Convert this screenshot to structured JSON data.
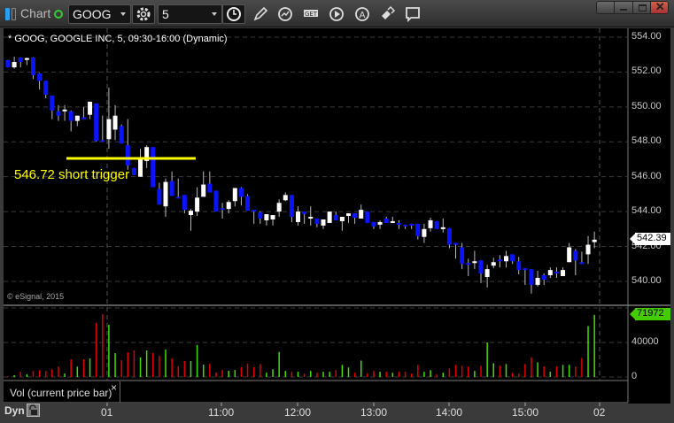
{
  "window": {
    "title": "Chart",
    "status_color": "#3c3"
  },
  "toolbar": {
    "symbol": "GOOG",
    "interval": "5",
    "tools": [
      "pencil-icon",
      "study-icon",
      "get-icon",
      "play-icon",
      "alert-icon",
      "link-icon",
      "comment-icon"
    ]
  },
  "chart": {
    "header": "* GOOG, GOOGLE INC, 5, 09:30-16:00 (Dynamic)",
    "copyright": "© eSignal, 2015",
    "annotation": "546.72 short trigger",
    "price_labels": [
      "554.00",
      "552.00",
      "550.00",
      "548.00",
      "546.00",
      "544.00",
      "542.00",
      "540.00"
    ],
    "price_values": [
      554,
      552,
      550,
      548,
      546,
      544,
      542,
      540
    ],
    "last_price": "542.39",
    "volume_labels": [
      "40000",
      "0"
    ],
    "volume_values": [
      40000,
      0
    ],
    "last_volume": "71972",
    "study_label": "Vol (current price bar)",
    "close_study": "×",
    "time_mode": "Dyn",
    "time_labels": [
      "01",
      "11:00",
      "12:00",
      "13:00",
      "14:00",
      "15:00",
      "02"
    ],
    "colors": {
      "up": "#ffffff",
      "down": "#0a14ff",
      "vol_up": "#44dd00",
      "vol_down": "#e00000",
      "trigger": "#ffff00"
    },
    "candles_ohlcv": [
      [
        552.68,
        552.7,
        552.27,
        552.27,
        1000
      ],
      [
        552.27,
        552.88,
        552.2,
        552.58,
        2000
      ],
      [
        552.83,
        552.85,
        552.27,
        552.58,
        6000
      ],
      [
        552.7,
        552.82,
        552.4,
        552.8,
        3000
      ],
      [
        552.83,
        552.85,
        551.6,
        551.82,
        7000
      ],
      [
        551.92,
        551.95,
        551.0,
        551.5,
        8000
      ],
      [
        551.5,
        551.5,
        550.5,
        550.7,
        7000
      ],
      [
        550.65,
        550.65,
        549.3,
        549.8,
        9000
      ],
      [
        549.75,
        550.1,
        549.2,
        549.5,
        12000
      ],
      [
        549.75,
        550.1,
        549.2,
        549.85,
        4000
      ],
      [
        549.75,
        549.8,
        548.6,
        549.2,
        20500
      ],
      [
        549.2,
        549.5,
        548.9,
        549.5,
        12000
      ],
      [
        549.4,
        550.0,
        549.3,
        549.3,
        20500
      ],
      [
        549.55,
        550.3,
        549.3,
        550.3,
        21500
      ],
      [
        550.2,
        550.2,
        548.0,
        548.05,
        62600
      ],
      [
        548.1,
        549.5,
        548.0,
        548.0,
        72800
      ],
      [
        548.15,
        551.1,
        547.6,
        549.3,
        60500
      ],
      [
        548.7,
        550.1,
        548.1,
        549.5,
        27700
      ],
      [
        548.9,
        549.0,
        547.9,
        547.9,
        19500
      ],
      [
        547.8,
        549.3,
        546.4,
        546.65,
        28700
      ],
      [
        546.5,
        546.5,
        546.1,
        546.1,
        30800
      ],
      [
        546.0,
        547.6,
        546.0,
        547.0,
        22600
      ],
      [
        546.9,
        547.8,
        546.5,
        547.7,
        30800
      ],
      [
        547.7,
        547.7,
        545.4,
        545.4,
        27700
      ],
      [
        545.3,
        545.65,
        544.4,
        544.4,
        24600
      ],
      [
        544.3,
        545.9,
        543.7,
        545.7,
        31800
      ],
      [
        545.75,
        546.3,
        544.9,
        544.9,
        21500
      ],
      [
        544.85,
        545.9,
        544.75,
        544.75,
        12300
      ],
      [
        544.95,
        544.95,
        543.9,
        544.1,
        18500
      ],
      [
        543.8,
        544.15,
        542.9,
        544.05,
        18500
      ],
      [
        544.0,
        545.4,
        543.75,
        544.8,
        37000
      ],
      [
        544.85,
        546.3,
        544.85,
        545.55,
        14400
      ],
      [
        545.6,
        546.3,
        545.1,
        545.1,
        15400
      ],
      [
        545.2,
        545.2,
        544.0,
        544.0,
        5500
      ],
      [
        544.2,
        544.5,
        543.6,
        544.1,
        8200
      ],
      [
        544.15,
        544.65,
        543.9,
        544.55,
        7200
      ],
      [
        544.6,
        545.35,
        544.3,
        545.35,
        8200
      ],
      [
        545.35,
        545.4,
        544.35,
        544.85,
        11300
      ],
      [
        544.9,
        545.0,
        544.05,
        544.05,
        15400
      ],
      [
        544.1,
        544.1,
        543.3,
        544.0,
        11300
      ],
      [
        543.95,
        544.0,
        543.3,
        543.6,
        15000
      ],
      [
        543.5,
        543.85,
        543.2,
        543.85,
        5000
      ],
      [
        543.55,
        543.8,
        543.2,
        543.8,
        9000
      ],
      [
        544.0,
        544.7,
        543.7,
        544.5,
        29000
      ],
      [
        544.65,
        545.1,
        544.6,
        544.95,
        7000
      ],
      [
        544.95,
        544.95,
        543.4,
        543.7,
        6000
      ],
      [
        543.4,
        544.3,
        543.2,
        544.0,
        6000
      ],
      [
        544.0,
        544.0,
        543.3,
        543.85,
        4000
      ],
      [
        543.6,
        544.3,
        543.2,
        543.7,
        7000
      ],
      [
        543.6,
        543.6,
        543.1,
        543.3,
        5000
      ],
      [
        543.2,
        543.55,
        543.0,
        543.55,
        6000
      ],
      [
        543.35,
        544.0,
        543.35,
        544.0,
        6000
      ],
      [
        543.8,
        544.0,
        543.5,
        543.5,
        8000
      ],
      [
        543.45,
        543.7,
        542.9,
        543.7,
        14000
      ],
      [
        543.75,
        543.9,
        543.35,
        543.9,
        11000
      ],
      [
        543.9,
        543.9,
        543.3,
        543.65,
        5000
      ],
      [
        543.6,
        544.4,
        543.6,
        544.1,
        19000
      ],
      [
        544.0,
        544.0,
        543.35,
        543.35,
        4000
      ],
      [
        543.4,
        543.4,
        543.0,
        543.15,
        7000
      ],
      [
        543.25,
        543.5,
        543.0,
        543.4,
        6000
      ],
      [
        543.6,
        543.7,
        543.35,
        543.35,
        6000
      ],
      [
        543.35,
        543.7,
        543.35,
        543.45,
        5000
      ],
      [
        543.35,
        543.5,
        543.0,
        543.3,
        6000
      ],
      [
        543.25,
        543.25,
        543.0,
        543.15,
        6000
      ],
      [
        543.3,
        543.3,
        543.0,
        543.2,
        4000
      ],
      [
        543.3,
        543.3,
        542.4,
        542.6,
        14000
      ],
      [
        542.55,
        543.3,
        542.2,
        543.0,
        6000
      ],
      [
        543.05,
        543.65,
        542.85,
        543.5,
        8000
      ],
      [
        543.45,
        543.45,
        543.0,
        543.0,
        3000
      ],
      [
        543.0,
        543.6,
        542.8,
        543.1,
        5000
      ],
      [
        543.05,
        543.05,
        541.9,
        542.1,
        10000
      ],
      [
        542.2,
        542.2,
        541.3,
        542.1,
        14000
      ],
      [
        541.95,
        542.2,
        540.7,
        541.0,
        13000
      ],
      [
        541.05,
        541.3,
        540.3,
        540.95,
        12000
      ],
      [
        541.1,
        541.75,
        540.7,
        541.15,
        7000
      ],
      [
        541.2,
        541.2,
        539.9,
        540.45,
        13000
      ],
      [
        540.25,
        540.95,
        539.65,
        540.7,
        40000
      ],
      [
        540.9,
        541.35,
        540.75,
        541.1,
        16000
      ],
      [
        541.25,
        541.5,
        540.8,
        541.15,
        13000
      ],
      [
        541.15,
        541.75,
        540.8,
        541.45,
        15000
      ],
      [
        541.55,
        541.55,
        541.0,
        541.15,
        5000
      ],
      [
        541.15,
        541.4,
        540.4,
        540.65,
        4000
      ],
      [
        540.75,
        540.75,
        539.8,
        540.65,
        15000
      ],
      [
        540.7,
        540.7,
        539.3,
        539.8,
        23000
      ],
      [
        539.8,
        540.6,
        539.7,
        540.2,
        17000
      ],
      [
        540.35,
        540.45,
        539.8,
        540.1,
        12000
      ],
      [
        540.35,
        540.8,
        540.2,
        540.65,
        6000
      ],
      [
        540.55,
        540.8,
        540.2,
        540.45,
        12000
      ],
      [
        540.3,
        540.8,
        540.3,
        540.65,
        14000
      ],
      [
        541.1,
        542.2,
        541.1,
        541.95,
        14000
      ],
      [
        541.75,
        541.85,
        540.35,
        541.2,
        12000
      ],
      [
        541.1,
        541.7,
        541.0,
        541.0,
        22000
      ],
      [
        541.55,
        542.6,
        541.0,
        542.1,
        59000
      ],
      [
        542.25,
        542.85,
        541.9,
        542.39,
        71972
      ]
    ]
  }
}
